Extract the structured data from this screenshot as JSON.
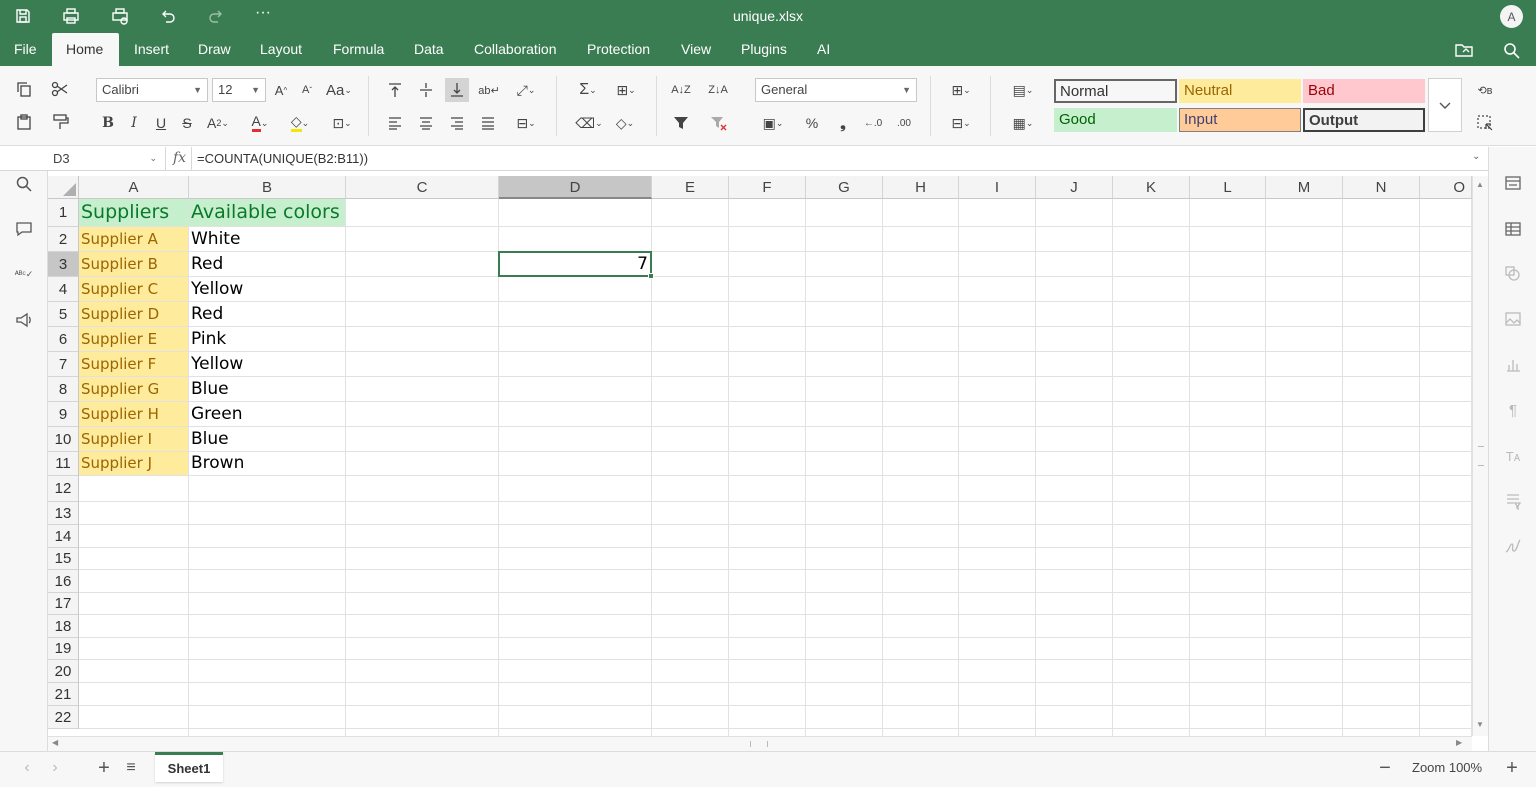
{
  "window": {
    "title": "unique.xlsx",
    "avatar_initial": "A"
  },
  "menu": {
    "items": [
      "File",
      "Home",
      "Insert",
      "Draw",
      "Layout",
      "Formula",
      "Data",
      "Collaboration",
      "Protection",
      "View",
      "Plugins",
      "AI"
    ],
    "active": "Home"
  },
  "ribbon": {
    "font_name": "Calibri",
    "font_size": "12",
    "number_format": "General",
    "styles": [
      {
        "label": "Normal",
        "bg": "#ffffff",
        "color": "#000000"
      },
      {
        "label": "Neutral",
        "bg": "#ffeb9c",
        "color": "#9c6500"
      },
      {
        "label": "Bad",
        "bg": "#ffc7ce",
        "color": "#9c0006"
      },
      {
        "label": "Good",
        "bg": "#c6efce",
        "color": "#006100"
      },
      {
        "label": "Input",
        "bg": "#ffcc99",
        "color": "#3f3f76"
      },
      {
        "label": "Output",
        "bg": "#f2f2f2",
        "color": "#3f3f3f"
      }
    ]
  },
  "formula_bar": {
    "cell_ref": "D3",
    "fx": "fx",
    "formula": "=COUNTA(UNIQUE(B2:B11))"
  },
  "sheet": {
    "columns": [
      "A",
      "B",
      "C",
      "D",
      "E",
      "F",
      "G",
      "H",
      "I",
      "J",
      "K",
      "L",
      "M",
      "N",
      "O"
    ],
    "rows": [
      "1",
      "2",
      "3",
      "4",
      "5",
      "6",
      "7",
      "8",
      "9",
      "10",
      "11",
      "12",
      "13",
      "14",
      "15",
      "16",
      "17",
      "18",
      "19",
      "20",
      "21",
      "22"
    ],
    "selected_col": "D",
    "selected_row": "3",
    "header_a": "Suppliers",
    "header_b": "Available colors",
    "suppliers": [
      "Supplier A",
      "Supplier B",
      "Supplier C",
      "Supplier D",
      "Supplier E",
      "Supplier F",
      "Supplier G",
      "Supplier H",
      "Supplier I",
      "Supplier J"
    ],
    "colors": [
      "White",
      "Red",
      "Yellow",
      "Red",
      "Pink",
      "Yellow",
      "Blue",
      "Green",
      "Blue",
      "Brown"
    ],
    "d3_value": "7"
  },
  "status": {
    "sheet_tab": "Sheet1",
    "zoom": "Zoom 100%"
  },
  "theme": {
    "accent": "#3a7d52"
  }
}
